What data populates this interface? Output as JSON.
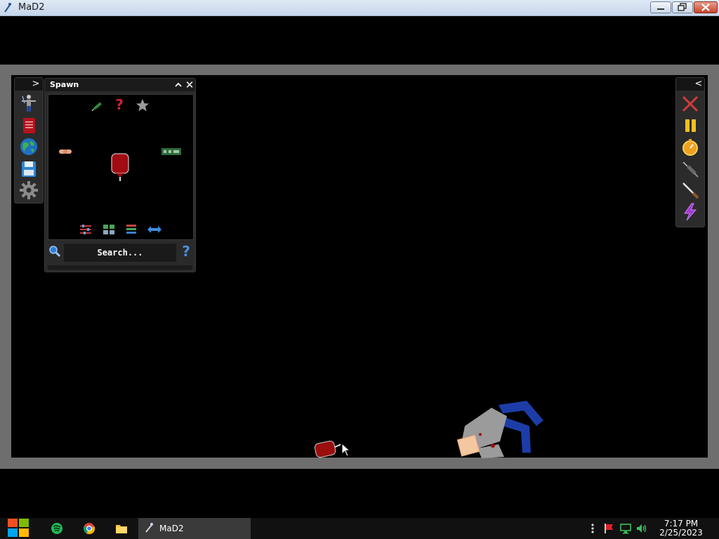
{
  "window": {
    "title": "MaD2",
    "app_icon": "syringe-figure-icon",
    "buttons": [
      "minimize-icon",
      "restore-icon",
      "close-icon"
    ]
  },
  "left_toolbar": {
    "expand_glyph": ">",
    "items": [
      "human-figure-icon",
      "red-book-icon",
      "globe-icon",
      "save-floppy-icon",
      "settings-gear-icon"
    ]
  },
  "spawn_panel": {
    "title": "Spawn",
    "collapse_glyph": "^",
    "close_glyph": "✕",
    "top_icons": [
      "syringe-icon",
      "question-mark-icon",
      "star-icon"
    ],
    "items": [
      "bandage-icon",
      "blood-bag-icon",
      "circuit-board-icon"
    ],
    "bottom_icons": [
      "filter-sliders-icon",
      "grid-view-icon",
      "list-view-icon",
      "swap-arrows-icon"
    ],
    "search_text": "Search...",
    "help_glyph": "?"
  },
  "right_toolbar": {
    "collapse_glyph": "<",
    "items": [
      "clear-x-icon",
      "pause-icon",
      "stopwatch-icon",
      "syringe-tool-icon",
      "knife-tool-icon",
      "lightning-icon"
    ]
  },
  "world": {
    "entities": [
      "blood-bag",
      "ragdoll-human"
    ]
  },
  "taskbar": {
    "start": "windows-logo-icon",
    "pinned": [
      "spotify-icon",
      "chrome-icon",
      "file-explorer-icon"
    ],
    "active_app_label": "MaD2",
    "tray": [
      "more-dots-icon",
      "flag-icon",
      "network-icon",
      "volume-icon"
    ],
    "time": "7:17 PM",
    "date": "2/25/2023"
  },
  "colors": {
    "frame_border": "#6e6e6e",
    "panel_bg": "#2a2a2a",
    "blood": "#9b0e0e",
    "ragdoll_blue": "#1c3da8",
    "ragdoll_gray": "#9b9b9b"
  }
}
